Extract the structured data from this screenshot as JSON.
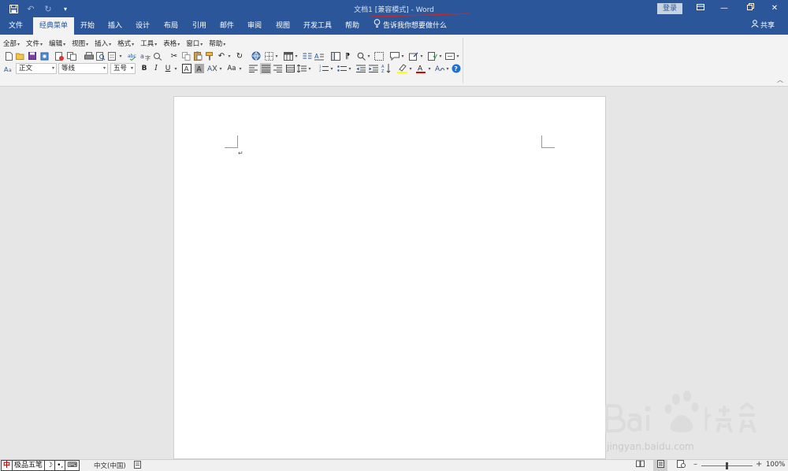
{
  "titlebar": {
    "doc_title": "文档1 [兼容模式]  -  Word",
    "login_label": "登录",
    "qat": {
      "save_icon": "save-icon",
      "undo_icon": "undo-icon",
      "redo_icon": "redo-icon",
      "customize_icon": "customize-icon"
    }
  },
  "tabs": [
    {
      "label": "文件"
    },
    {
      "label": "经典菜单"
    },
    {
      "label": "开始"
    },
    {
      "label": "插入"
    },
    {
      "label": "设计"
    },
    {
      "label": "布局"
    },
    {
      "label": "引用"
    },
    {
      "label": "邮件"
    },
    {
      "label": "审阅"
    },
    {
      "label": "视图"
    },
    {
      "label": "开发工具"
    },
    {
      "label": "帮助"
    }
  ],
  "tellme": {
    "label": "告诉我你想要做什么"
  },
  "share": {
    "label": "共享"
  },
  "classic_menu": [
    {
      "label": "全部"
    },
    {
      "label": "文件"
    },
    {
      "label": "编辑"
    },
    {
      "label": "视图"
    },
    {
      "label": "插入"
    },
    {
      "label": "格式"
    },
    {
      "label": "工具"
    },
    {
      "label": "表格"
    },
    {
      "label": "窗口"
    },
    {
      "label": "帮助"
    }
  ],
  "format_bar": {
    "style_value": "正文",
    "font_value": "等线",
    "size_value": "五号",
    "bold": "B",
    "italic": "I",
    "underline": "U",
    "change_case": "Aa"
  },
  "document": {
    "paragraph_mark": "↵"
  },
  "watermark": {
    "url": "jingyan.baidu.com"
  },
  "statusbar": {
    "ime": {
      "mode": "中",
      "name": "极品五笔",
      "moon": "☽",
      "punct": "•,",
      "kbd": "⌨"
    },
    "language": "中文(中国)",
    "zoom_percent": "100%",
    "zoom_fraction": 0.5
  },
  "colors": {
    "brand": "#2b579a",
    "ribbon_bg": "#f3f3f3",
    "canvas_bg": "#e6e6e6",
    "highlight_yellow": "#ffff00",
    "font_color_red": "#e00000",
    "help_blue": "#1e6fd0"
  }
}
